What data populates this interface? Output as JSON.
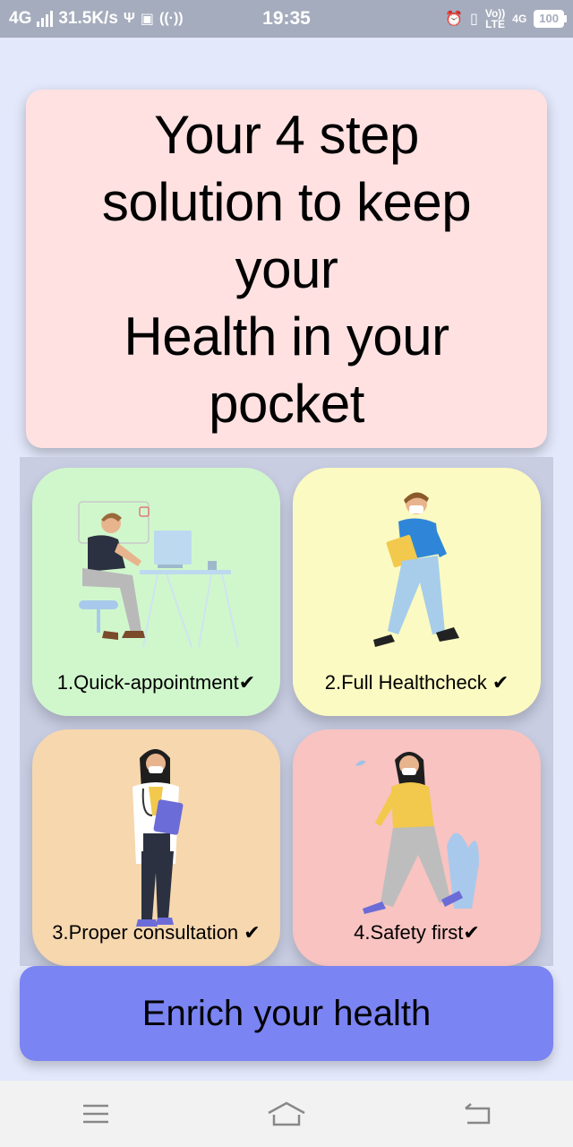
{
  "status_bar": {
    "network": "4G",
    "speed": "31.5K/s",
    "time": "19:35",
    "volte_top": "Vo))",
    "volte_bottom": "LTE",
    "network_right": "4G",
    "battery": "100"
  },
  "header": {
    "title": "Your 4 step\nsolution to keep\nyour\nHealth in your\npocket"
  },
  "cards": [
    {
      "label": "1.Quick-appointment✔",
      "bg": "#d0f7cc",
      "icon": "doctor-at-desk-illustration"
    },
    {
      "label": "2.Full Healthcheck ✔",
      "bg": "#fbfac2",
      "icon": "masked-man-walking-with-clipboard-illustration"
    },
    {
      "label": "3.Proper consultation ✔",
      "bg": "#f6d7ae",
      "icon": "doctor-with-stethoscope-illustration"
    },
    {
      "label": "4.Safety first✔",
      "bg": "#f8c3c0",
      "icon": "masked-woman-walking-illustration"
    }
  ],
  "cta": {
    "label": "Enrich your health",
    "bg": "#7a84f2"
  },
  "nav": {
    "menu_icon": "menu-icon",
    "home_icon": "home-icon",
    "back_icon": "back-icon"
  }
}
